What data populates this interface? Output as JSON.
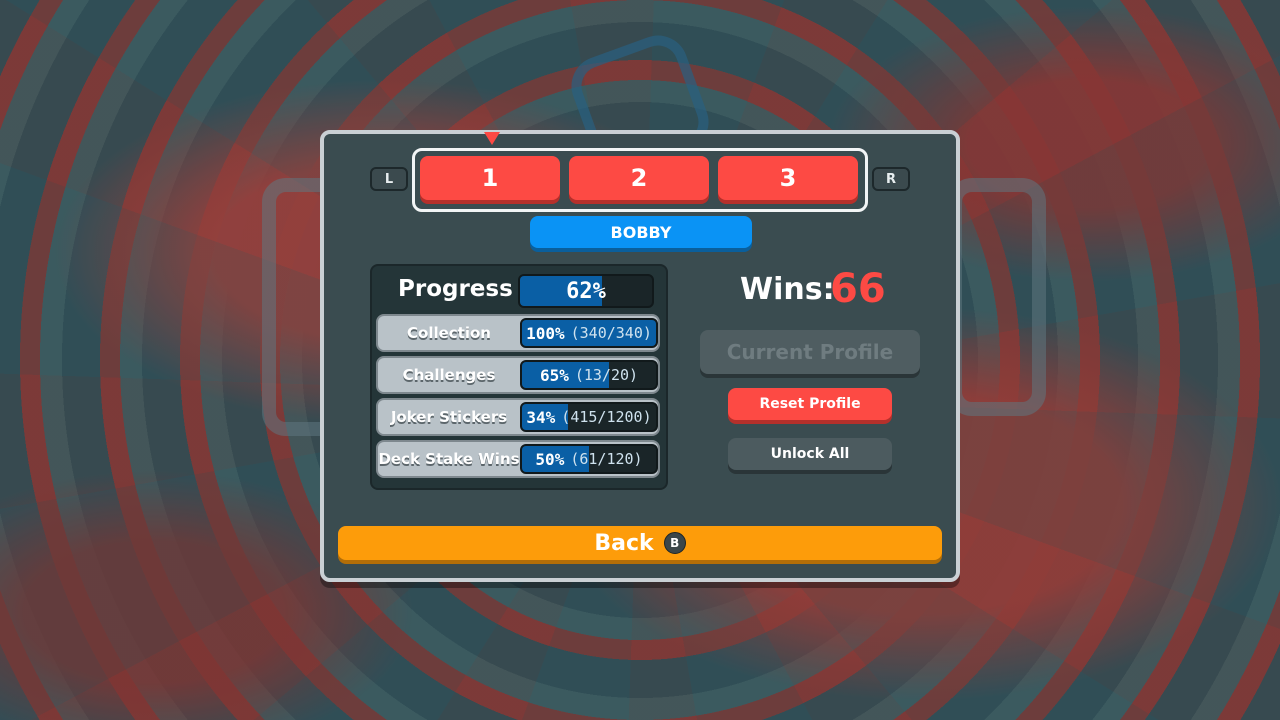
{
  "profile_tabs": [
    {
      "label": "1",
      "selected": true
    },
    {
      "label": "2",
      "selected": false
    },
    {
      "label": "3",
      "selected": false
    }
  ],
  "shoulder_left": "L",
  "shoulder_right": "R",
  "profile_name": "BOBBY",
  "progress": {
    "title": "Progress",
    "overall": {
      "text": "62%",
      "fraction": 0.62
    },
    "rows": [
      {
        "label": "Collection",
        "percent": "100%",
        "detail": "(340/340)",
        "fraction": 1.0
      },
      {
        "label": "Challenges",
        "percent": "65%",
        "detail": "(13/20)",
        "fraction": 0.65
      },
      {
        "label": "Joker Stickers",
        "percent": "34%",
        "detail": "(415/1200)",
        "fraction": 0.34
      },
      {
        "label": "Deck Stake Wins",
        "percent": "50%",
        "detail": "(61/120)",
        "fraction": 0.5
      }
    ]
  },
  "wins": {
    "label": "Wins:",
    "value": "66"
  },
  "buttons": {
    "current_profile": "Current Profile",
    "reset_profile": "Reset Profile",
    "unlock_all": "Unlock All",
    "back": "Back",
    "back_badge": "B"
  },
  "colors": {
    "accent_red": "#fd4a44",
    "accent_blue": "#0a93f5",
    "accent_orange": "#fd9c0a",
    "panel": "#3a4c50"
  }
}
